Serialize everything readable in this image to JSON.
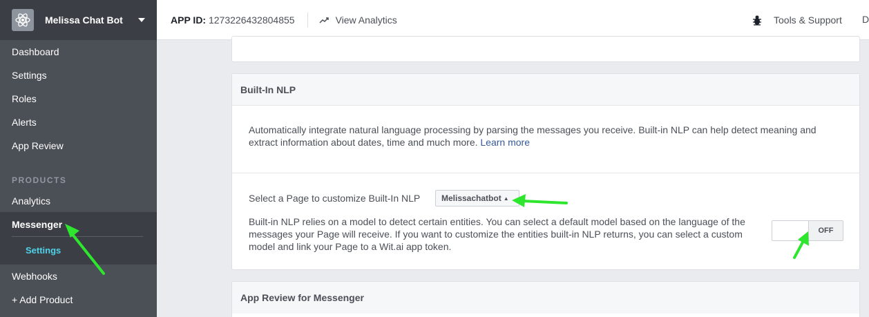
{
  "app": {
    "name": "Melissa Chat Bot"
  },
  "sidebar": {
    "items": [
      "Dashboard",
      "Settings",
      "Roles",
      "Alerts",
      "App Review"
    ],
    "products_header": "PRODUCTS",
    "analytics": "Analytics",
    "messenger": "Messenger",
    "messenger_sub": "Settings",
    "webhooks": "Webhooks",
    "add_product": "+ Add Product"
  },
  "topbar": {
    "app_id_label": "APP ID:",
    "app_id_value": "1273226432804855",
    "view_analytics": "View Analytics",
    "tools_support": "Tools & Support",
    "truncated": "D"
  },
  "nlp_panel": {
    "title": "Built-In NLP",
    "description": "Automatically integrate natural language processing by parsing the messages you receive. Built-in NLP can help detect meaning and extract information about dates, time and much more.",
    "learn_more": "Learn more",
    "select_label": "Select a Page to customize Built-In NLP",
    "selected_page": "Melissachatbot",
    "model_description": "Built-in NLP relies on a model to detect certain entities. You can select a default model based on the language of the messages your Page will receive. If you want to customize the entities built-in NLP returns, you can select a custom model and link your Page to a Wit.ai app token.",
    "toggle_state": "OFF"
  },
  "review_panel": {
    "title": "App Review for Messenger"
  },
  "colors": {
    "annotation_arrow": "#2ee62e",
    "link": "#365899",
    "sidebar_active_sub": "#4fd1e8"
  }
}
